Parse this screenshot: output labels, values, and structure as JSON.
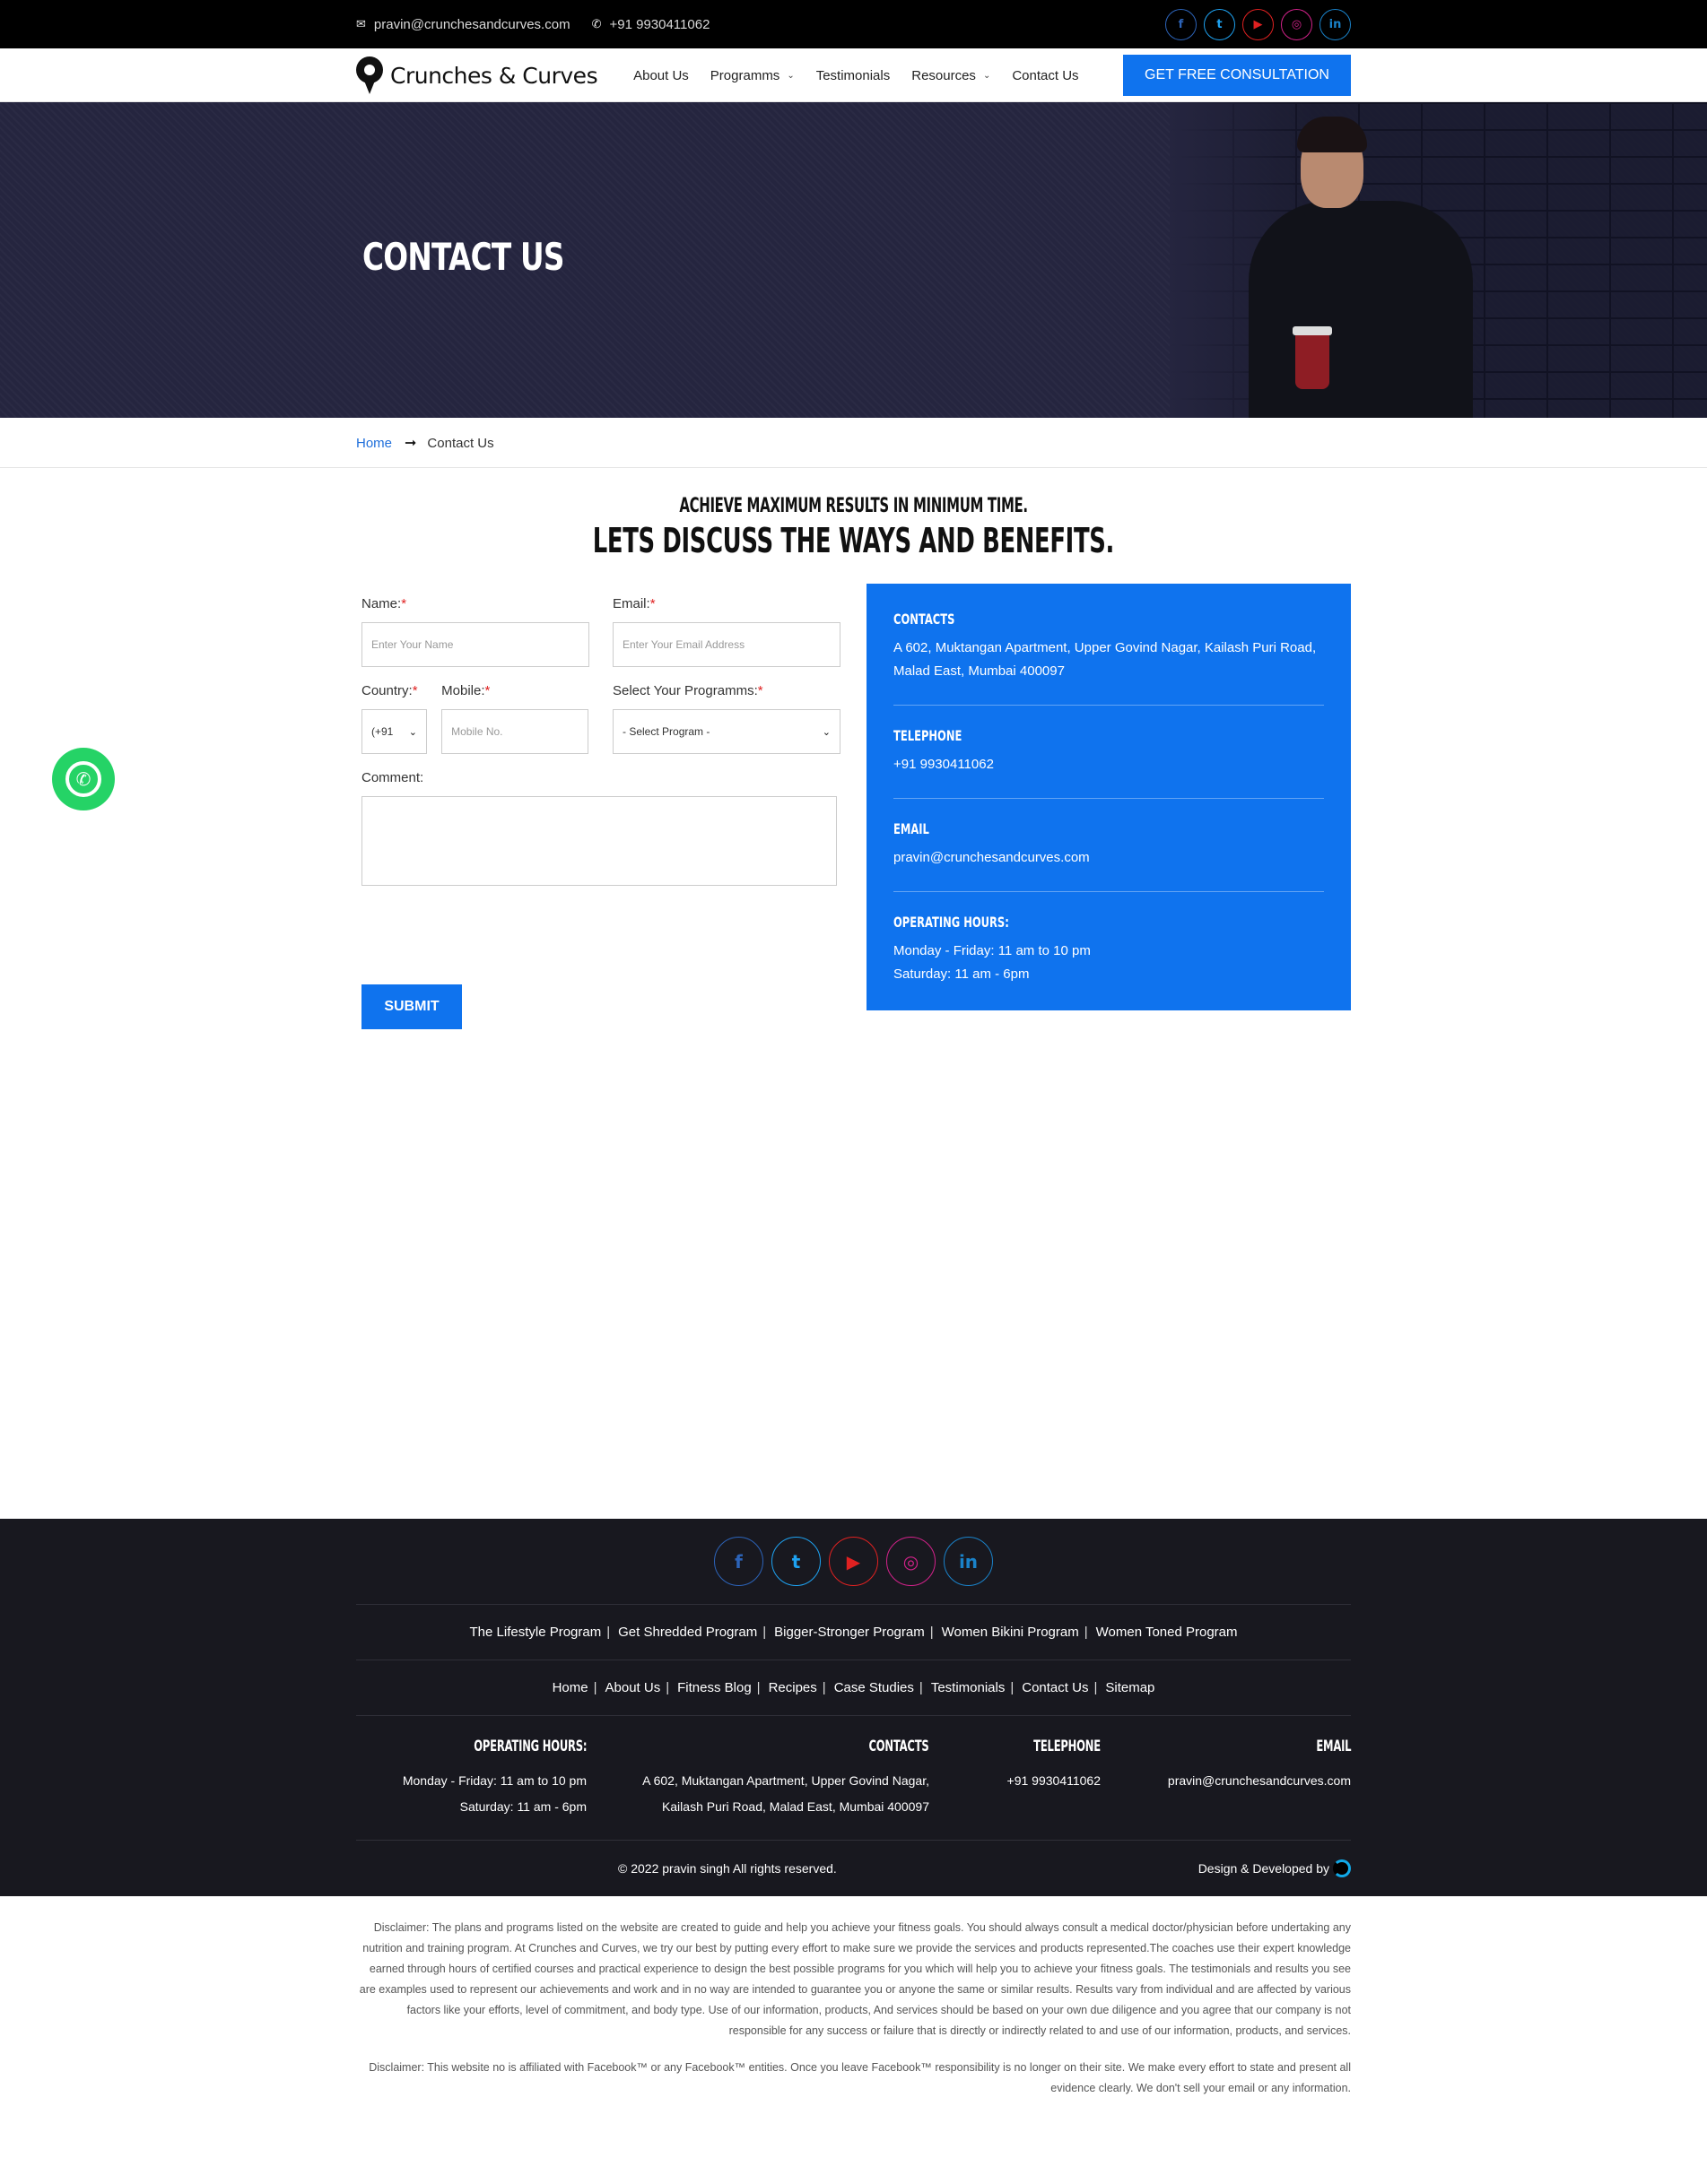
{
  "topbar": {
    "email": "pravin@crunchesandcurves.com",
    "phone": "+91 9930411062",
    "social_icons": [
      "facebook-icon",
      "twitter-icon",
      "youtube-icon",
      "instagram-icon",
      "linkedin-icon"
    ]
  },
  "nav": {
    "logo_text": "Crunches & Curves",
    "items": [
      {
        "label": "About Us"
      },
      {
        "label": "Programms"
      },
      {
        "label": "Testimonials"
      },
      {
        "label": "Resources"
      },
      {
        "label": "Contact Us"
      }
    ],
    "cta": "GET FREE CONSULTATION"
  },
  "hero": {
    "title": "CONTACT US"
  },
  "breadcrumb": {
    "home": "Home",
    "current": "Contact Us"
  },
  "intro": {
    "subtitle": "ACHIEVE MAXIMUM RESULTS IN MINIMUM TIME.",
    "title": "LETS DISCUSS THE WAYS AND BENEFITS."
  },
  "form": {
    "name_label": "Name:",
    "name_placeholder": "Enter Your Name",
    "email_label": "Email:",
    "email_placeholder": "Enter Your Email Address",
    "country_label": "Country:",
    "country_value": "(+91",
    "mobile_label": "Mobile:",
    "mobile_placeholder": "Mobile No.",
    "program_label": "Select Your Programms:",
    "program_value": "- Select Program -",
    "comment_label": "Comment:",
    "required_mark": "*",
    "submit": "SUBMIT"
  },
  "contact_box": {
    "contacts_title": "CONTACTS",
    "contacts_value": "A 602, Muktangan Apartment, Upper Govind Nagar, Kailash Puri Road, Malad East, Mumbai 400097",
    "telephone_title": "TELEPHONE",
    "telephone_value": "+91 9930411062",
    "email_title": "EMAIL",
    "email_value": "pravin@crunchesandcurves.com",
    "hours_title": "OPERATING HOURS:",
    "hours_line1": "Monday - Friday: 11 am to 10 pm",
    "hours_line2": "Saturday: 11 am - 6pm"
  },
  "footer": {
    "programs": [
      "The Lifestyle Program",
      "Get Shredded Program",
      "Bigger-Stronger Program",
      "Women Bikini Program",
      "Women Toned Program"
    ],
    "links": [
      "Home",
      "About Us",
      "Fitness Blog",
      "Recipes",
      "Case Studies",
      "Testimonials",
      "Contact Us",
      "Sitemap"
    ],
    "separator": "|",
    "hours_title": "OPERATING HOURS:",
    "hours_line1": "Monday - Friday: 11 am to 10 pm",
    "hours_line2": "Saturday: 11 am - 6pm",
    "contacts_title": "CONTACTS",
    "contacts_line1": "A 602, Muktangan Apartment, Upper Govind Nagar,",
    "contacts_line2": "Kailash Puri Road, Malad East, Mumbai 400097",
    "telephone_title": "TELEPHONE",
    "telephone_value": "+91 9930411062",
    "email_title": "EMAIL",
    "email_value": "pravin@crunchesandcurves.com",
    "copyright": "© 2022 pravin singh All rights reserved.",
    "developed": "Design & Developed by"
  },
  "disclaimer": {
    "p1": "Disclaimer: The plans and programs listed on the website are created to guide and help you achieve your fitness goals. You should always consult a medical doctor/physician before undertaking any nutrition and training program. At Crunches and Curves, we try our best by putting every effort to make sure we provide the services and products represented.The coaches use their expert knowledge earned through hours of certified courses and practical experience to design the best possible programs for you which will help you to achieve your fitness goals. The testimonials and results you see are examples used to represent our achievements and work and in no way are intended to guarantee you or anyone the same or similar results. Results vary from individual and are affected by various factors like your efforts, level of commitment, and body type. Use of our information, products, And services should be based on your own due diligence and you agree that our company is not responsible for any success or failure that is directly or indirectly related to and use of our information, products, and services.",
    "p2": "Disclaimer: This website no is affiliated with Facebook™ or any Facebook™ entities. Once you leave Facebook™ responsibility is no longer on their site. We make every effort to state and present all evidence clearly. We don't sell your email or any information."
  },
  "colors": {
    "accent": "#0f73ee",
    "hero_bg": "#25253f",
    "footer_bg": "#18181f",
    "whatsapp": "#25d366"
  }
}
